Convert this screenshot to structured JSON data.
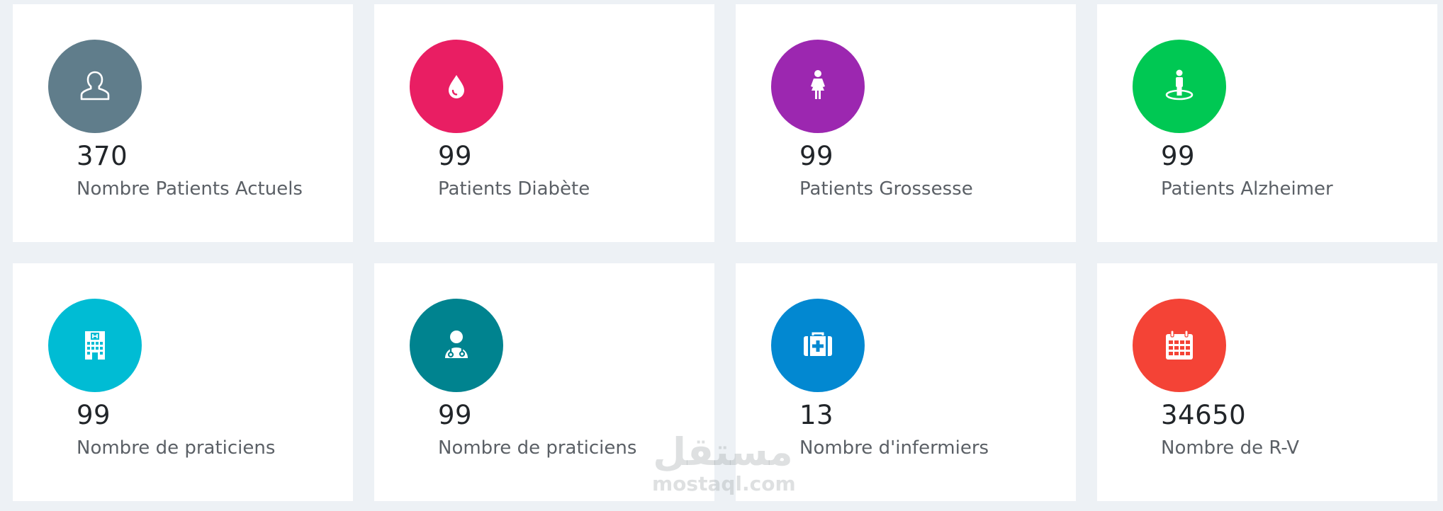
{
  "stats": [
    {
      "value": "370",
      "label": "Nombre Patients Actuels",
      "color": "#607d8b",
      "icon": "user-icon"
    },
    {
      "value": "99",
      "label": "Patients Diabète",
      "color": "#e91e63",
      "icon": "blood-drop-icon"
    },
    {
      "value": "99",
      "label": "Patients Grossesse",
      "color": "#9c27b0",
      "icon": "woman-icon"
    },
    {
      "value": "99",
      "label": "Patients Alzheimer",
      "color": "#00c853",
      "icon": "person-circle-icon"
    },
    {
      "value": "99",
      "label": "Nombre de praticiens",
      "color": "#00bcd4",
      "icon": "hospital-building-icon"
    },
    {
      "value": "99",
      "label": "Nombre de praticiens",
      "color": "#00838f",
      "icon": "doctor-icon"
    },
    {
      "value": "13",
      "label": "Nombre d'infermiers",
      "color": "#0288d1",
      "icon": "medical-kit-icon"
    },
    {
      "value": "34650",
      "label": "Nombre de R-V",
      "color": "#f44336",
      "icon": "calendar-icon"
    }
  ],
  "watermark": {
    "arabic": "مستقل",
    "latin": "mostaql.com"
  }
}
